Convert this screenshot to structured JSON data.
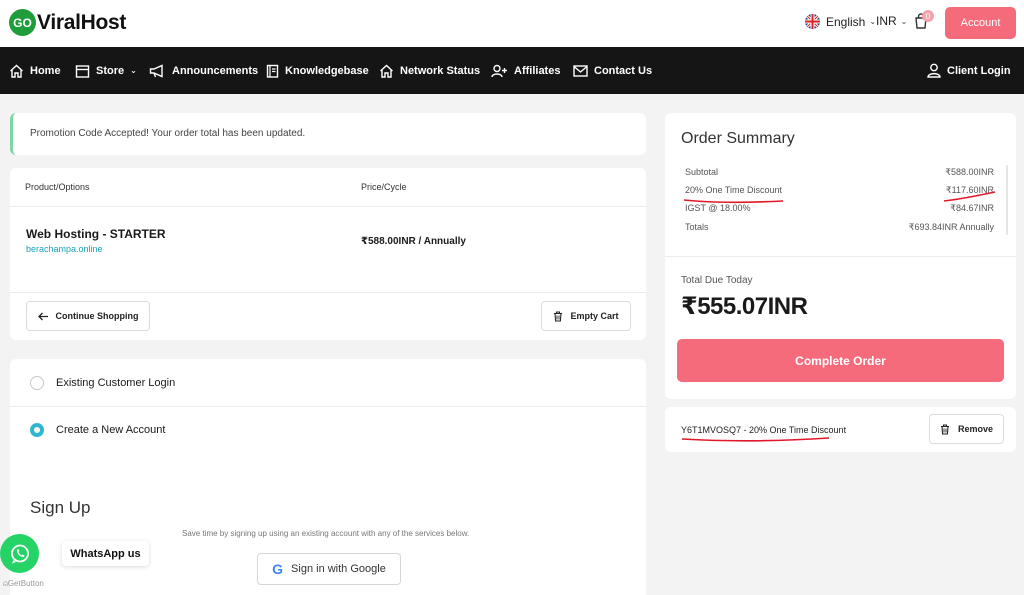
{
  "brand": {
    "badge": "GO",
    "name": "ViralHost"
  },
  "topbar": {
    "language": "English",
    "currency": "INR",
    "cart_count": "0",
    "account_label": "Account"
  },
  "nav": {
    "items": [
      {
        "label": "Home",
        "icon": "home-icon"
      },
      {
        "label": "Store",
        "icon": "store-icon"
      },
      {
        "label": "Announcements",
        "icon": "megaphone-icon"
      },
      {
        "label": "Knowledgebase",
        "icon": "book-icon"
      },
      {
        "label": "Network Status",
        "icon": "home-icon"
      },
      {
        "label": "Affiliates",
        "icon": "user-plus-icon"
      },
      {
        "label": "Contact Us",
        "icon": "mail-icon"
      }
    ],
    "client_login": "Client Login"
  },
  "promo_alert": "Promotion Code Accepted! Your order total has been updated.",
  "cart": {
    "col_product": "Product/Options",
    "col_price": "Price/Cycle",
    "item": {
      "name": "Web Hosting - STARTER",
      "domain": "berachampa.online",
      "price": "₹588.00INR / Annually"
    },
    "continue_label": "Continue Shopping",
    "empty_label": "Empty Cart"
  },
  "account_options": {
    "existing": "Existing Customer Login",
    "new": "Create a New Account",
    "selected": "new"
  },
  "signup": {
    "title": "Sign Up",
    "subtitle": "Save time by signing up using an existing account with any of the services below.",
    "google_label": "Sign in with Google"
  },
  "summary": {
    "title": "Order Summary",
    "rows": [
      {
        "label": "Subtotal",
        "value": "₹588.00INR"
      },
      {
        "label": "20% One Time Discount",
        "value": "₹117.60INR"
      },
      {
        "label": "IGST @ 18.00%",
        "value": "₹84.67INR"
      },
      {
        "label": "Totals",
        "value": "₹693.84INR Annually"
      }
    ],
    "due_label": "Total Due Today",
    "due_amount": "₹555.07INR",
    "complete_label": "Complete Order"
  },
  "applied_promo": {
    "text": "Y6T1MVOSQ7 - 20% One Time Discount",
    "remove_label": "Remove"
  },
  "whatsapp": {
    "tooltip": "WhatsApp us",
    "credit": "GetButton"
  },
  "colors": {
    "accent": "#f56b7b",
    "nav_bg": "#151515",
    "link": "#1aa3b8",
    "radio_active": "#2fb7cf",
    "whatsapp": "#25d366",
    "annotation": "#e0192a"
  }
}
